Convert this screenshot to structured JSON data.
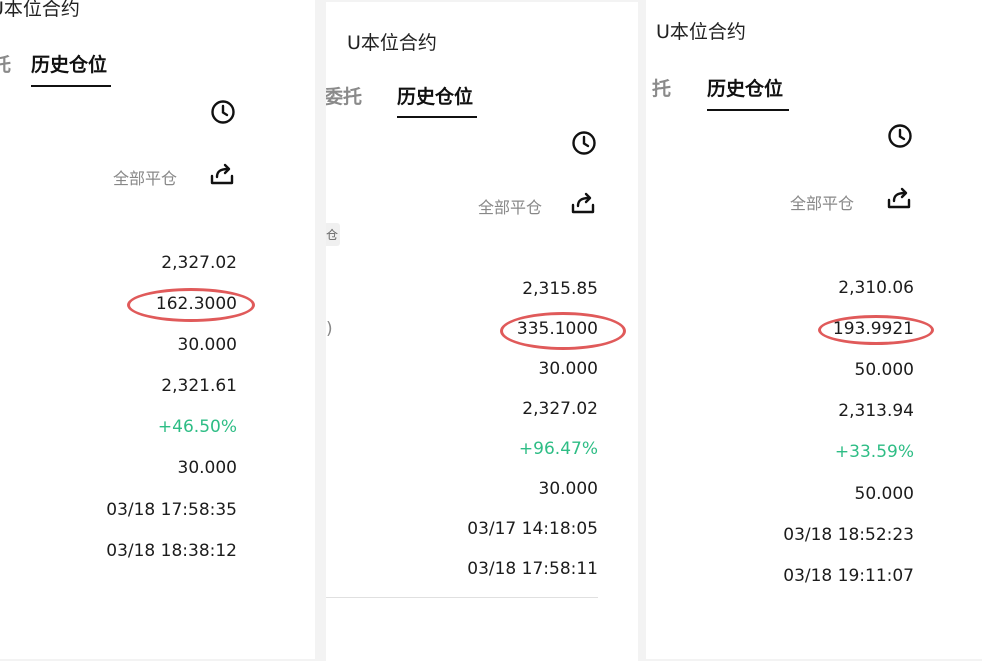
{
  "panels": [
    {
      "title": "U本位合约",
      "tabs": [
        "托",
        "历史仓位"
      ],
      "close_all": "全部平仓",
      "values": [
        "2,327.02",
        "162.3000",
        "30.000",
        "2,321.61",
        "+46.50%",
        "30.000",
        "03/18 17:58:35",
        "03/18 18:38:12"
      ]
    },
    {
      "title": "U本位合约",
      "tabs": "委托",
      "tab_active": "历史仓位",
      "close_all": "全部平仓",
      "partial_label": "仓",
      "partial_paren": ")",
      "values": [
        "2,315.85",
        "335.1000",
        "30.000",
        "2,327.02",
        "+96.47%",
        "30.000",
        "03/17 14:18:05",
        "03/18 17:58:11"
      ]
    },
    {
      "title": "U本位合约",
      "tabs": "托",
      "tab_active": "历史仓位",
      "close_all": "全部平仓",
      "values": [
        "2,310.06",
        "193.9921",
        "50.000",
        "2,313.94",
        "+33.59%",
        "50.000",
        "03/18 18:52:23",
        "03/18 19:11:07"
      ]
    }
  ],
  "icons": {
    "history": "clock-icon",
    "share": "share-icon"
  },
  "colors": {
    "positive": "#2ebd85",
    "highlight": "#e05a5a"
  }
}
